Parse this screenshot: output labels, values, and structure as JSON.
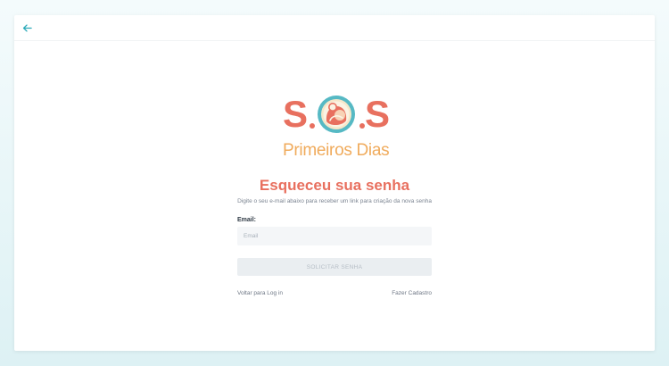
{
  "colors": {
    "accent": "#e8705f",
    "logo_orange": "#f0ab5c",
    "logo_teal": "#56b9c4",
    "back_icon": "#2aa9b8"
  },
  "header": {
    "back_icon": "arrow-left-icon"
  },
  "logo": {
    "letter_left": "S",
    "letter_right": "S",
    "subtitle": "Primeiros Dias"
  },
  "form": {
    "title": "Esqueceu sua senha",
    "description": "Digite o seu e-mail abaixo para receber um link para criação da nova senha",
    "email_label": "Email:",
    "email_placeholder": "Email",
    "email_value": "",
    "submit_label": "SOLICITAR SENHA"
  },
  "links": {
    "back_to_login": "Voltar para Log in",
    "sign_up": "Fazer Cadastro"
  }
}
